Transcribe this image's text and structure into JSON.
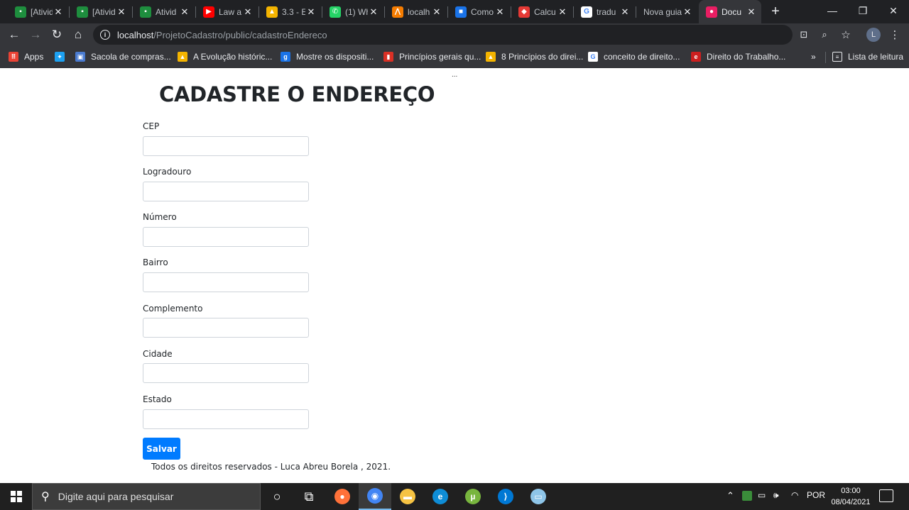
{
  "browser": {
    "tabs": [
      {
        "title": "[Ativid",
        "icon": "classroom-icon",
        "color": "#1e8e3e",
        "glyph": "▪"
      },
      {
        "title": "[Ativid",
        "icon": "classroom-icon",
        "color": "#1e8e3e",
        "glyph": "▪"
      },
      {
        "title": "Ativid",
        "icon": "classroom-icon",
        "color": "#1e8e3e",
        "glyph": "▪"
      },
      {
        "title": "Law a",
        "icon": "youtube-icon",
        "color": "#ff0000",
        "glyph": "▶"
      },
      {
        "title": "3.3 - E",
        "icon": "drive-icon",
        "color": "#f4b400",
        "glyph": "▲"
      },
      {
        "title": "(1) Wh",
        "icon": "whatsapp-icon",
        "color": "#25d366",
        "glyph": "✆"
      },
      {
        "title": "localh",
        "icon": "xampp-icon",
        "color": "#f57c00",
        "glyph": "⋀"
      },
      {
        "title": "Como",
        "icon": "cube-icon",
        "color": "#1a73e8",
        "glyph": "■"
      },
      {
        "title": "Calcu",
        "icon": "calculator-icon",
        "color": "#e53935",
        "glyph": "◆"
      },
      {
        "title": "tradu",
        "icon": "google-icon",
        "color": "#ffffff",
        "glyph": "G"
      },
      {
        "title": "Nova guia",
        "icon": "",
        "color": "",
        "glyph": ""
      },
      {
        "title": "Docu",
        "icon": "document-icon",
        "color": "#e91e63",
        "glyph": "●",
        "active": true
      }
    ],
    "new_tab_label": "+",
    "window_controls": {
      "minimize": "—",
      "restore": "❐",
      "close": "✕"
    },
    "url_host": "localhost",
    "url_path": "/ProjetoCadastro/public/cadastroEndereco",
    "profile_initial": "L",
    "bookmarks": [
      {
        "label": "Apps",
        "icon": "apps-grid-icon",
        "color": "#ea4335",
        "glyph": "⠿"
      },
      {
        "label": "",
        "icon": "twitter-icon",
        "color": "#1da1f2",
        "glyph": "✦"
      },
      {
        "label": "Sacola de compras...",
        "icon": "bag-icon",
        "color": "#4a7bd0",
        "glyph": "▣"
      },
      {
        "label": "A Evolução históric...",
        "icon": "drive-icon",
        "color": "#f4b400",
        "glyph": "▲"
      },
      {
        "label": "Mostre os dispositi...",
        "icon": "letter-g-icon",
        "color": "#1a73e8",
        "glyph": "g"
      },
      {
        "label": "Princípios gerais qu...",
        "icon": "bookmark-icon",
        "color": "#d93025",
        "glyph": "▮"
      },
      {
        "label": "8 Princípios do direi...",
        "icon": "drive-icon",
        "color": "#f4b400",
        "glyph": "▲"
      },
      {
        "label": "conceito de direito...",
        "icon": "google-icon",
        "color": "#ffffff",
        "glyph": "G"
      },
      {
        "label": "Direito do Trabalho...",
        "icon": "opera-icon",
        "color": "#cc1f1f",
        "glyph": "e"
      }
    ],
    "more_bookmarks": "»",
    "reading_list": "Lista de leitura"
  },
  "page": {
    "title": "CADASTRE O ENDEREÇO",
    "ellipsis": "...",
    "fields": [
      {
        "label": "CEP",
        "value": "",
        "placeholder": ""
      },
      {
        "label": "Logradouro",
        "value": "",
        "placeholder": ""
      },
      {
        "label": "Número",
        "value": "",
        "placeholder": ""
      },
      {
        "label": "Bairro",
        "value": "",
        "placeholder": ""
      },
      {
        "label": "Complemento",
        "value": "",
        "placeholder": ""
      },
      {
        "label": "Cidade",
        "value": "",
        "placeholder": ""
      },
      {
        "label": "Estado",
        "value": "",
        "placeholder": ""
      }
    ],
    "save_label": "Salvar",
    "footer": "Todos os direitos reservados - Luca Abreu Borela , 2021.",
    "accent": "#007bff"
  },
  "taskbar": {
    "search_placeholder": "Digite aqui para pesquisar",
    "apps": [
      {
        "name": "cortana-icon",
        "color": "transparent",
        "glyph": "○"
      },
      {
        "name": "task-view-icon",
        "color": "transparent",
        "glyph": "⧉"
      },
      {
        "name": "firefox-icon",
        "color": "#ff7139",
        "glyph": "●"
      },
      {
        "name": "chrome-icon",
        "color": "#4285f4",
        "glyph": "◉",
        "active": true
      },
      {
        "name": "file-explorer-icon",
        "color": "#f6c343",
        "glyph": "▬"
      },
      {
        "name": "edge-icon",
        "color": "#0f8dd6",
        "glyph": "e"
      },
      {
        "name": "utorrent-icon",
        "color": "#78b53e",
        "glyph": "µ"
      },
      {
        "name": "vscode-icon",
        "color": "#0078d4",
        "glyph": "⟩"
      },
      {
        "name": "notepad-icon",
        "color": "#8ec5e8",
        "glyph": "▭"
      }
    ],
    "language": "POR",
    "time": "03:00",
    "date": "08/04/2021"
  }
}
